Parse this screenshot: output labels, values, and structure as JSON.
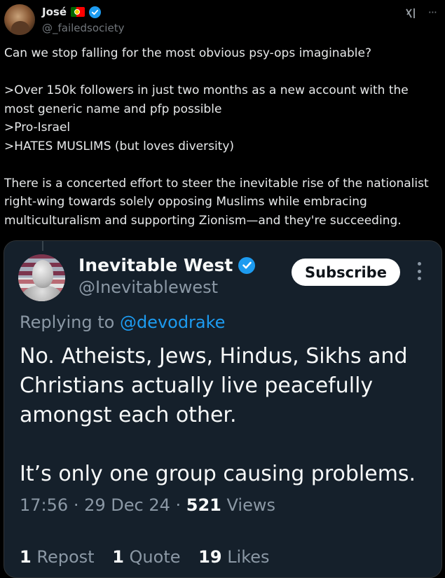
{
  "post": {
    "author": {
      "display_name": "José",
      "handle": "@_failedsociety",
      "flag_icon": "portugal-flag-icon",
      "verified": true
    },
    "text_paragraphs": [
      "Can we stop falling for the most obvious psy-ops imaginable?",
      "",
      ">Over 150k followers in just two months as a new account with the most generic name and pfp possible",
      ">Pro-Israel",
      ">HATES MUSLIMS (but loves diversity)",
      "",
      "There is a concerted effort to steer the inevitable rise of the nationalist right-wing towards solely opposing Muslims while embracing multiculturalism and supporting Zionism—and they're succeeding."
    ],
    "icons": {
      "grok": "grok-icon",
      "more": "more-icon"
    }
  },
  "quoted": {
    "author": {
      "display_name": "Inevitable West",
      "handle": "@Inevitablewest",
      "verified": true
    },
    "subscribe_label": "Subscribe",
    "replying_prefix": "Replying to ",
    "replying_mention": "@devodrake",
    "body_paragraphs": [
      "No. Atheists, Jews, Hindus, Sikhs and Christians actually live peacefully amongst each other.",
      "",
      "It’s only one group causing problems."
    ],
    "time": "17:56",
    "date": "29 Dec 24",
    "views_count": "521",
    "views_label": "Views",
    "stats": {
      "reposts_count": "1",
      "reposts_label": "Repost",
      "quotes_count": "1",
      "quotes_label": "Quote",
      "likes_count": "19",
      "likes_label": "Likes"
    }
  },
  "colors": {
    "background": "#000000",
    "card_background": "#15202b",
    "text": "#e7e9ea",
    "muted": "#71767b",
    "link": "#1d9bf0",
    "verified": "#1d9bf0"
  }
}
